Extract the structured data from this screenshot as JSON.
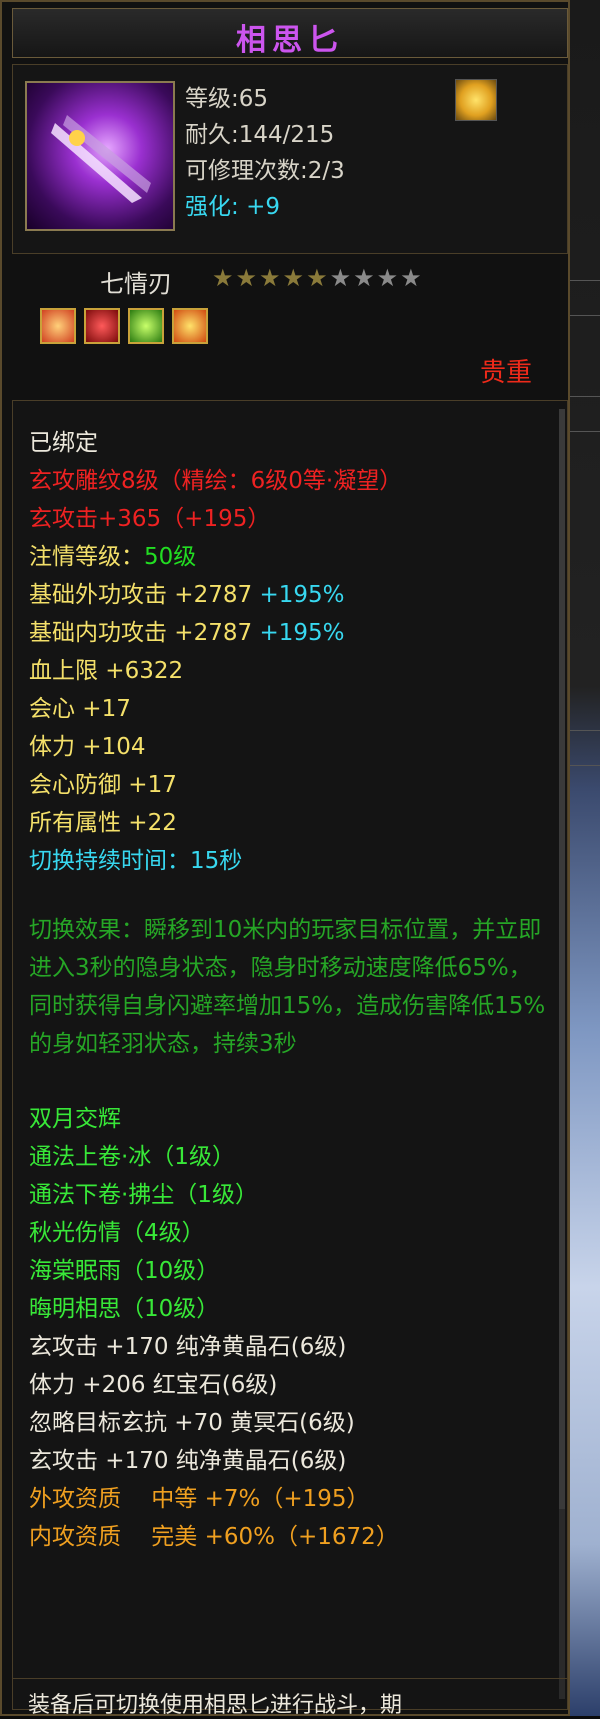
{
  "tooltip": {
    "title": "相思匕",
    "stats": {
      "level": "等级:65",
      "durability": "耐久:144/215",
      "repair_times": "可修理次数:2/3",
      "enhance_label": "强化:",
      "enhance_value": "+9"
    },
    "quality": {
      "name": "七情刃",
      "stars_filled": 5,
      "stars_total": 9,
      "grade": "贵重"
    },
    "gems": [
      "gem-orange",
      "gem-red",
      "gem-green",
      "gem-gold"
    ],
    "lines": {
      "bound": "已绑定",
      "engrave": "玄攻雕纹8级（精绘：6级0等·凝望）",
      "xuan_attack": "玄攻击+365（+195）",
      "zhuqing_label": "注情等级：",
      "zhuqing_value": "50级",
      "base_outer_label": "基础外功攻击 +2787",
      "base_outer_pct": "+195%",
      "base_inner_label": "基础内功攻击 +2787",
      "base_inner_pct": "+195%",
      "hp": "血上限 +6322",
      "crit": "会心 +17",
      "stamina": "体力 +104",
      "crit_def": "会心防御 +17",
      "all_attr": "所有属性 +22",
      "switch_duration": "切换持续时间：15秒",
      "switch_effect": "切换效果：瞬移到10米内的玩家目标位置，并立即进入3秒的隐身状态，隐身时移动速度降低65%，同时获得自身闪避率增加15%，造成伤害降低15%的身如轻羽状态，持续3秒",
      "set_name": "双月交辉",
      "skill1": "通法上卷·冰（1级）",
      "skill2": "通法下卷·拂尘（1级）",
      "skill3": "秋光伤情（4级）",
      "skill4": "海棠眠雨（10级）",
      "skill5": "晦明相思（10级）",
      "gem1": "玄攻击 +170 纯净黄晶石(6级)",
      "gem2": "体力 +206 红宝石(6级)",
      "gem3": "忽略目标玄抗 +70 黄冥石(6级)",
      "gem4": "玄攻击 +170 纯净黄晶石(6级)",
      "apt_outer": "外攻资质　 中等 +7%（+195）",
      "apt_inner": "内攻资质　 完美 +60%（+1672）"
    },
    "footer": "装备后可切换使用相思匕进行战斗，期"
  },
  "colors": {
    "title": "#cc55ee",
    "precious": "#ee2a1a",
    "border": "#5a4a2c"
  }
}
